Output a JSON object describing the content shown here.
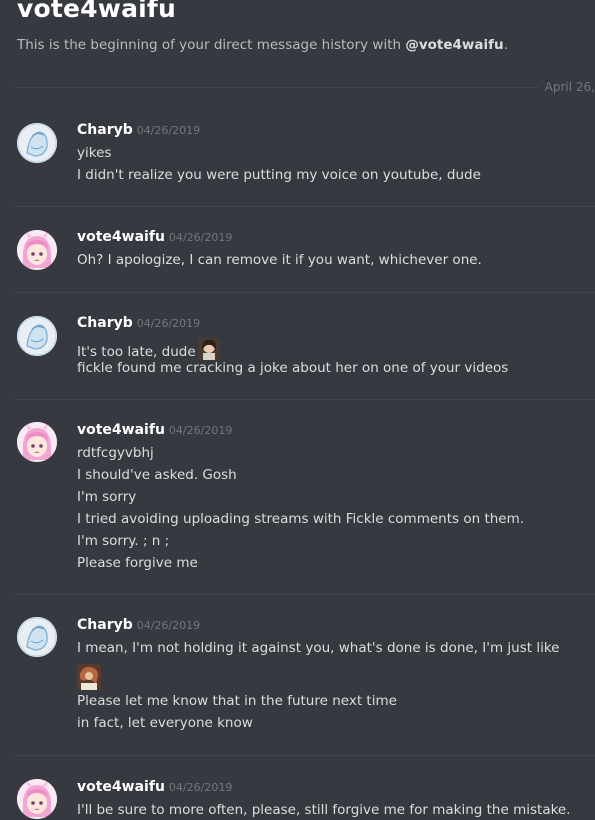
{
  "header": {
    "title": "vote4waifu",
    "intro_prefix": "This is the beginning of your direct message history with ",
    "intro_handle": "@vote4waifu",
    "intro_suffix": "."
  },
  "date_divider": "April 26,",
  "colors": {
    "background": "#36393f",
    "username": "#ffffff",
    "timestamp": "#72767d",
    "text": "#dcddde"
  },
  "messages": [
    {
      "author": "Charyb",
      "timestamp": "04/26/2019",
      "avatar": "charyb-avatar",
      "lines": [
        "yikes",
        "I didn't realize you were putting my voice on youtube, dude"
      ]
    },
    {
      "author": "vote4waifu",
      "timestamp": "04/26/2019",
      "avatar": "vote4waifu-avatar",
      "lines": [
        "Oh? I apologize, I can remove it if you want, whichever one."
      ]
    },
    {
      "author": "Charyb",
      "timestamp": "04/26/2019",
      "avatar": "charyb-avatar",
      "lines": [
        "It's too late, dude",
        "fickle found me cracking a joke about her on one of your videos"
      ],
      "emote": "custom-emote"
    },
    {
      "author": "vote4waifu",
      "timestamp": "04/26/2019",
      "avatar": "vote4waifu-avatar",
      "lines": [
        "rdtfcgyvbhj",
        "I should've asked. Gosh",
        "I'm sorry",
        "I tried avoiding uploading streams with Fickle comments on them.",
        "I'm sorry. ; n ;",
        "Please forgive me"
      ]
    },
    {
      "author": "Charyb",
      "timestamp": "04/26/2019",
      "avatar": "charyb-avatar",
      "lines": [
        "I mean, I'm not holding it against you, what's done is done, I'm just like",
        "Please let me know that in the future next time",
        "in fact, let everyone know"
      ],
      "emote": "custom-emote"
    },
    {
      "author": "vote4waifu",
      "timestamp": "04/26/2019",
      "avatar": "vote4waifu-avatar",
      "lines": [
        "I'll be sure to more often, please, still forgive me for making the mistake."
      ]
    }
  ]
}
